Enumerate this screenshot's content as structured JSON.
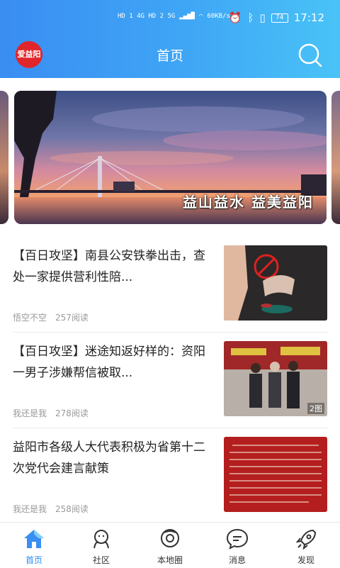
{
  "status_bar": {
    "network_left": "HD 1 4G HD 2 5G",
    "speed": "60KB/s",
    "battery": "74",
    "time": "17:12"
  },
  "header": {
    "logo_text": "爱益阳",
    "title": "首页"
  },
  "banner": {
    "caption": "益山益水  益美益阳"
  },
  "news": [
    {
      "title": "【百日攻坚】南县公安铁拳出击，查处一家提供营利性陪...",
      "author": "悟空不空",
      "reads": "257阅读",
      "image_count": ""
    },
    {
      "title": "【百日攻坚】迷途知返好样的：资阳一男子涉嫌帮信被取...",
      "author": "我还是我",
      "reads": "278阅读",
      "image_count": "2图"
    },
    {
      "title": "益阳市各级人大代表积极为省第十二次党代会建言献策",
      "author": "我还是我",
      "reads": "258阅读",
      "image_count": ""
    }
  ],
  "tabbar": [
    {
      "label": "首页",
      "icon": "home-icon",
      "active": true
    },
    {
      "label": "社区",
      "icon": "community-icon",
      "active": false
    },
    {
      "label": "本地圈",
      "icon": "local-circle-icon",
      "active": false
    },
    {
      "label": "消息",
      "icon": "message-icon",
      "active": false
    },
    {
      "label": "发现",
      "icon": "rocket-icon",
      "active": false
    }
  ],
  "colors": {
    "header_gradient_start": "#3a8df2",
    "header_gradient_end": "#49c3f7",
    "active_tab": "#2f8cef",
    "logo_red": "#e0262b"
  }
}
